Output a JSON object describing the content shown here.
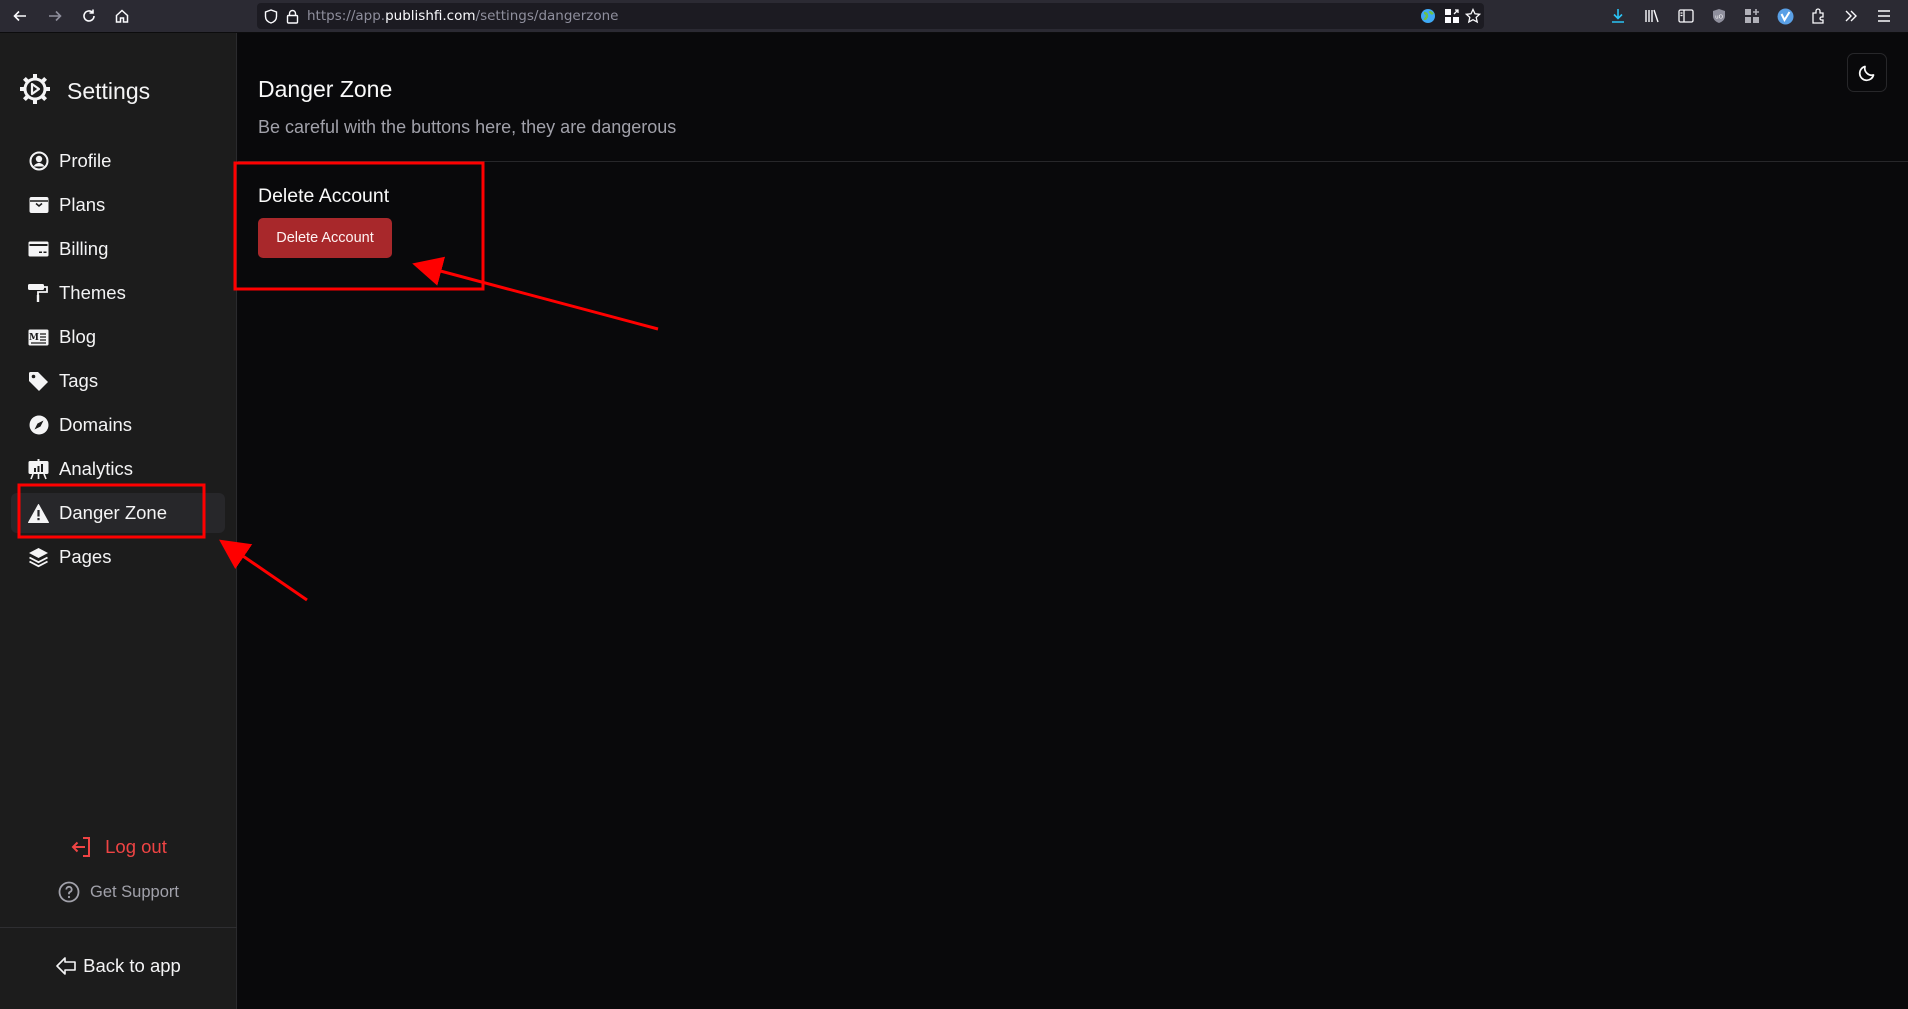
{
  "browser": {
    "url_prefix": "https://app.",
    "url_domain": "publishfi.com",
    "url_path": "/settings/dangerzone",
    "icons": [
      "back-icon",
      "forward-icon",
      "reload-icon",
      "home-icon",
      "shield-icon",
      "lock-icon",
      "extension-globe-icon",
      "qr-icon",
      "bookmark-star-icon",
      "downloads-icon",
      "library-icon",
      "sidebar-icon",
      "ublock-icon",
      "extensions-add-icon",
      "vpn-icon",
      "puzzle-icon",
      "overflow-icon",
      "menu-icon"
    ]
  },
  "sidebar": {
    "title": "Settings",
    "items": [
      {
        "label": "Profile",
        "icon": "profile-icon"
      },
      {
        "label": "Plans",
        "icon": "plans-icon"
      },
      {
        "label": "Billing",
        "icon": "billing-icon"
      },
      {
        "label": "Themes",
        "icon": "themes-icon"
      },
      {
        "label": "Blog",
        "icon": "blog-icon"
      },
      {
        "label": "Tags",
        "icon": "tag-icon"
      },
      {
        "label": "Domains",
        "icon": "compass-icon"
      },
      {
        "label": "Analytics",
        "icon": "analytics-icon"
      },
      {
        "label": "Danger Zone",
        "icon": "warning-icon",
        "active": true
      },
      {
        "label": "Pages",
        "icon": "layers-icon"
      }
    ],
    "logout_label": "Log out",
    "support_label": "Get Support",
    "back_label": "Back to app"
  },
  "main": {
    "title": "Danger Zone",
    "subtitle": "Be careful with the buttons here, they are dangerous",
    "section_title": "Delete Account",
    "delete_button_label": "Delete Account",
    "theme_toggle_icon": "moon-icon"
  },
  "colors": {
    "danger": "#a8282b",
    "logout": "#ef4444",
    "annotation": "#ff0000"
  }
}
